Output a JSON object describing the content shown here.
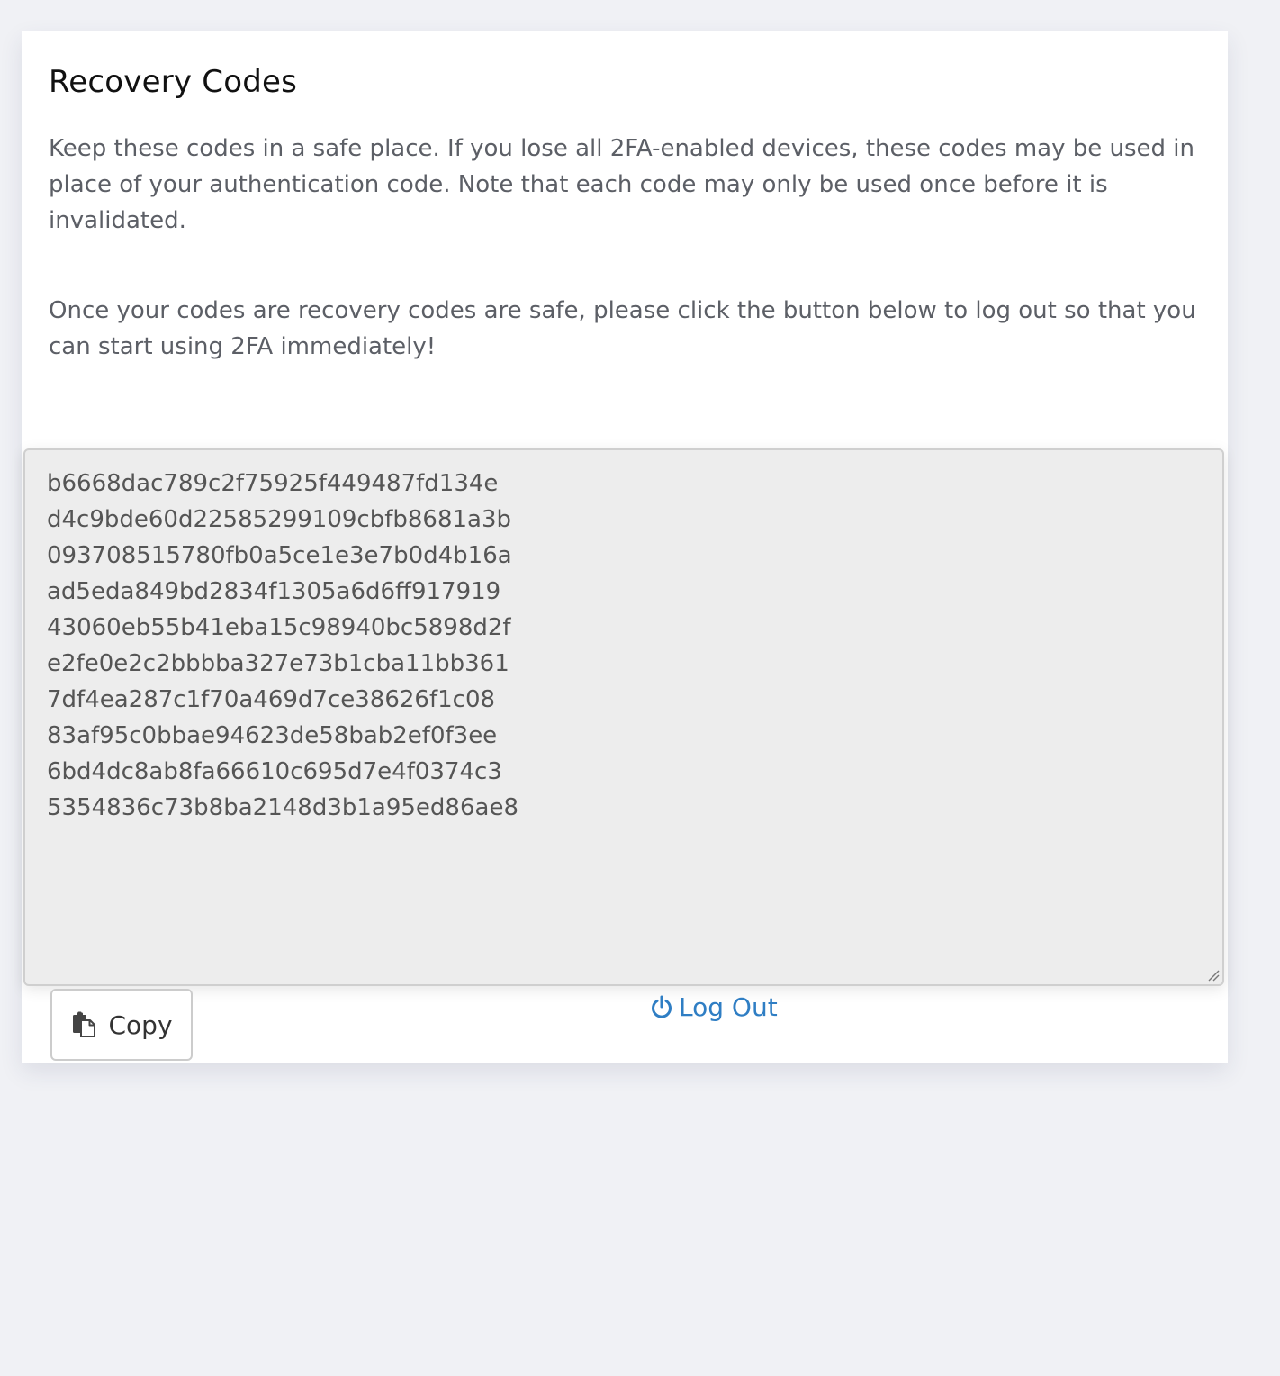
{
  "card": {
    "title": "Recovery Codes",
    "paragraph_1": "Keep these codes in a safe place. If you lose all 2FA-enabled devices, these codes may be used in place of your authentication code. Note that each code may only be used once before it is invalidated.",
    "paragraph_2": "Once your codes are recovery codes are safe, please click the button below to log out so that you can start using 2FA immediately!"
  },
  "codes": [
    "b6668dac789c2f75925f449487fd134e",
    "d4c9bde60d22585299109cbfb8681a3b",
    "093708515780fb0a5ce1e3e7b0d4b16a",
    "ad5eda849bd2834f1305a6d6ff917919",
    "43060eb55b41eba15c98940bc5898d2f",
    "e2fe0e2c2bbbba327e73b1cba11bb361",
    "7df4ea287c1f70a469d7ce38626f1c08",
    "83af95c0bbae94623de58bab2ef0f3ee",
    "6bd4dc8ab8fa66610c695d7e4f0374c3",
    "5354836c73b8ba2148d3b1a95ed86ae8"
  ],
  "actions": {
    "copy_label": "Copy",
    "copy_icon": "copy-icon",
    "logout_label": "Log Out",
    "logout_icon": "power-icon"
  },
  "colors": {
    "page_background": "#f0f1f5",
    "link": "#2f7ec4",
    "textarea_background": "#ededed"
  }
}
